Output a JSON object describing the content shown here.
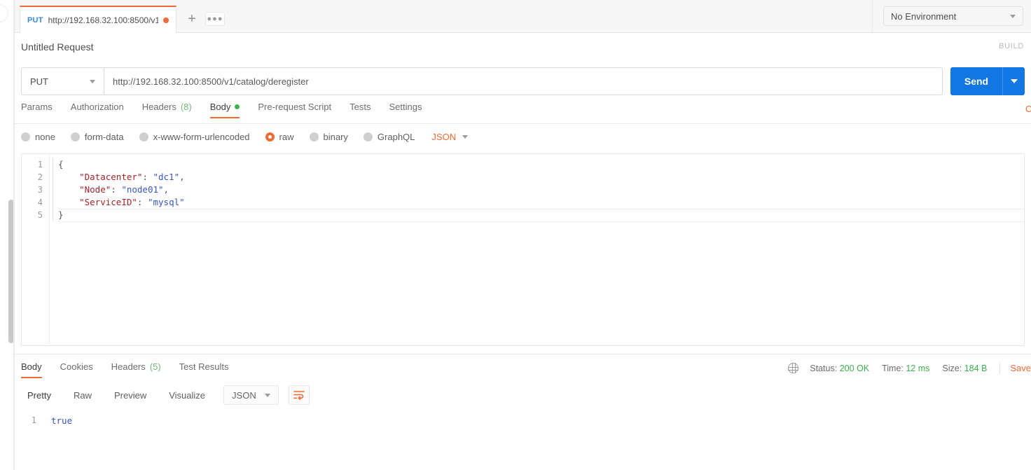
{
  "sidebar": {
    "scrollbar_name": "vertical-scrollbar"
  },
  "tabstrip": {
    "tab": {
      "method": "PUT",
      "url": "http://192.168.32.100:8500/v1/...",
      "unsaved": true
    },
    "new_tab_label": "+",
    "more_label": "●●●",
    "environment": {
      "selected": "No Environment"
    }
  },
  "request": {
    "title": "Untitled Request",
    "build_label": "BUILD",
    "method": "PUT",
    "url": "http://192.168.32.100:8500/v1/catalog/deregister",
    "send_label": "Send",
    "tabs": [
      {
        "label": "Params",
        "count": "",
        "active": false
      },
      {
        "label": "Authorization",
        "count": "",
        "active": false
      },
      {
        "label": "Headers",
        "count": "(8)",
        "active": false
      },
      {
        "label": "Body",
        "count": "",
        "active": true
      },
      {
        "label": "Pre-request Script",
        "count": "",
        "active": false
      },
      {
        "label": "Tests",
        "count": "",
        "active": false
      },
      {
        "label": "Settings",
        "count": "",
        "active": false
      }
    ],
    "cookies_clipped_label": "C",
    "body_types": [
      {
        "label": "none",
        "selected": false
      },
      {
        "label": "form-data",
        "selected": false
      },
      {
        "label": "x-www-form-urlencoded",
        "selected": false
      },
      {
        "label": "raw",
        "selected": true
      },
      {
        "label": "binary",
        "selected": false
      },
      {
        "label": "GraphQL",
        "selected": false
      }
    ],
    "body_format": "JSON",
    "body_lines": [
      {
        "num": "1",
        "text": "{"
      },
      {
        "num": "2",
        "text": "    \"Datacenter\": \"dc1\","
      },
      {
        "num": "3",
        "text": "    \"Node\": \"node01\","
      },
      {
        "num": "4",
        "text": "    \"ServiceID\": \"mysql\""
      },
      {
        "num": "5",
        "text": "}"
      }
    ]
  },
  "response": {
    "tabs": [
      {
        "label": "Body",
        "count": "",
        "active": true
      },
      {
        "label": "Cookies",
        "count": "",
        "active": false
      },
      {
        "label": "Headers",
        "count": "(5)",
        "active": false
      },
      {
        "label": "Test Results",
        "count": "",
        "active": false
      }
    ],
    "status_label": "Status:",
    "status_value": "200 OK",
    "time_label": "Time:",
    "time_value": "12 ms",
    "size_label": "Size:",
    "size_value": "184 B",
    "save_label": "Save",
    "view_modes": [
      {
        "label": "Pretty",
        "active": true
      },
      {
        "label": "Raw",
        "active": false
      },
      {
        "label": "Preview",
        "active": false
      },
      {
        "label": "Visualize",
        "active": false
      }
    ],
    "format": "JSON",
    "body_line_number": "1",
    "body_text": "true"
  },
  "colors": {
    "accent_orange": "#f06b33",
    "send_blue": "#1277e2",
    "status_green": "#3cb14a",
    "method_blue": "#3b8ad9"
  }
}
